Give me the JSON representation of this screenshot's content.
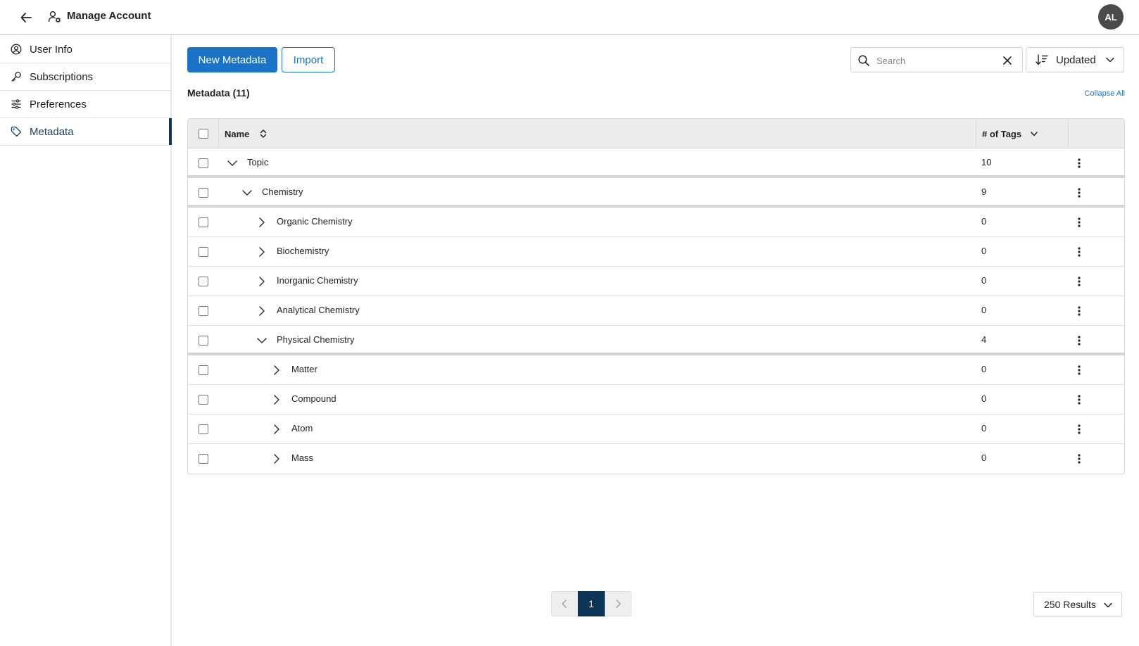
{
  "header": {
    "back_icon": "arrow-left-icon",
    "account_icon": "user-gear-icon",
    "title": "Manage Account",
    "avatar_initials": "AL"
  },
  "sidebar": {
    "items": [
      {
        "label": "User Info",
        "icon": "user-circle-icon",
        "active": false
      },
      {
        "label": "Subscriptions",
        "icon": "key-icon",
        "active": false
      },
      {
        "label": "Preferences",
        "icon": "sliders-icon",
        "active": false
      },
      {
        "label": "Metadata",
        "icon": "tag-icon",
        "active": true
      }
    ]
  },
  "toolbar": {
    "new_label": "New Metadata",
    "import_label": "Import",
    "search_placeholder": "Search",
    "search_value": "",
    "sort_label": "Updated"
  },
  "list": {
    "title": "Metadata (11)",
    "collapse_all_label": "Collapse All"
  },
  "table": {
    "columns": {
      "name": "Name",
      "tags": "# of Tags"
    },
    "rows": [
      {
        "name": "Topic",
        "count": "10",
        "level": 0,
        "expanded": true
      },
      {
        "name": "Chemistry",
        "count": "9",
        "level": 1,
        "expanded": true
      },
      {
        "name": "Organic Chemistry",
        "count": "0",
        "level": 2,
        "expanded": false
      },
      {
        "name": "Biochemistry",
        "count": "0",
        "level": 2,
        "expanded": false
      },
      {
        "name": "Inorganic Chemistry",
        "count": "0",
        "level": 2,
        "expanded": false
      },
      {
        "name": "Analytical Chemistry",
        "count": "0",
        "level": 2,
        "expanded": false
      },
      {
        "name": "Physical Chemistry",
        "count": "4",
        "level": 2,
        "expanded": true
      },
      {
        "name": "Matter",
        "count": "0",
        "level": 3,
        "expanded": false
      },
      {
        "name": "Compound",
        "count": "0",
        "level": 3,
        "expanded": false
      },
      {
        "name": "Atom",
        "count": "0",
        "level": 3,
        "expanded": false
      },
      {
        "name": "Mass",
        "count": "0",
        "level": 3,
        "expanded": false
      }
    ]
  },
  "pagination": {
    "current_page": "1",
    "results_label": "250 Results"
  },
  "colors": {
    "primary": "#1b73c7",
    "nav_active": "#0d3558",
    "avatar_bg": "#4a4a4a"
  }
}
